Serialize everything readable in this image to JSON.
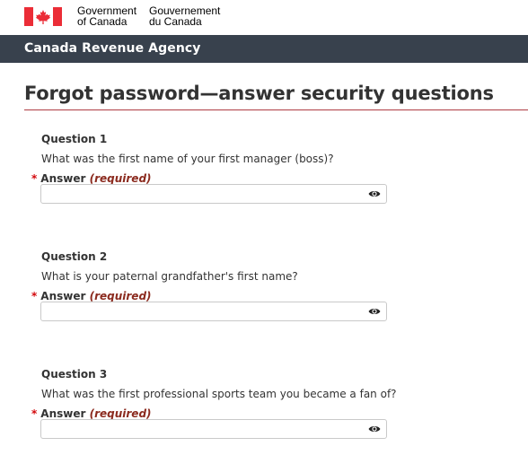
{
  "header": {
    "signature_en_line1": "Government",
    "signature_en_line2": "of Canada",
    "signature_fr_line1": "Gouvernement",
    "signature_fr_line2": "du Canada",
    "agency": "Canada Revenue Agency",
    "flag_color": "#eb2d37"
  },
  "main": {
    "title": "Forgot password—answer security questions",
    "questions": [
      {
        "label": "Question 1",
        "text": "What was the first name of your first manager (boss)?",
        "answer_label": "Answer",
        "required_text": "(required)",
        "required_marker": "*",
        "value": ""
      },
      {
        "label": "Question 2",
        "text": "What is your paternal grandfather's first name?",
        "answer_label": "Answer",
        "required_text": "(required)",
        "required_marker": "*",
        "value": ""
      },
      {
        "label": "Question 3",
        "text": "What was the first professional sports team you became a fan of?",
        "answer_label": "Answer",
        "required_text": "(required)",
        "required_marker": "*",
        "value": ""
      }
    ],
    "show_password_icon": "eye-icon"
  },
  "colors": {
    "agency_bar": "#38414d",
    "title_rule": "#af3c43",
    "required_star": "#d3080c",
    "required_text": "#8b2a1e"
  }
}
